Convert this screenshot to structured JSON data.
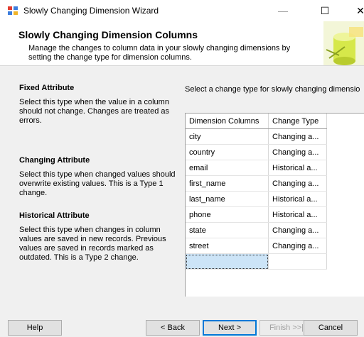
{
  "window": {
    "title": "Slowly Changing Dimension Wizard"
  },
  "header": {
    "title": "Slowly Changing Dimension Columns",
    "description": "Manage the changes to column data in your slowly changing dimensions by setting the change type for dimension columns."
  },
  "sections": {
    "fixed": {
      "title": "Fixed Attribute",
      "body": "Select this type when the value in a column should not change. Changes are treated as errors."
    },
    "changing": {
      "title": "Changing Attribute",
      "body": "Select this type when changed values should overwrite existing values. This is a Type 1 change."
    },
    "historical": {
      "title": "Historical Attribute",
      "body": "Select this type when changes in column values are saved in new records. Previous values are saved in records marked as outdated. This is a Type 2 change."
    }
  },
  "instruction": "Select a change type for slowly changing dimensio",
  "grid": {
    "headers": [
      "Dimension Columns",
      "Change Type"
    ],
    "rows": [
      [
        "city",
        "Changing a..."
      ],
      [
        "country",
        "Changing a..."
      ],
      [
        "email",
        "Historical a..."
      ],
      [
        "first_name",
        "Changing a..."
      ],
      [
        "last_name",
        "Historical a..."
      ],
      [
        "phone",
        "Historical a..."
      ],
      [
        "state",
        "Changing a..."
      ],
      [
        "street",
        "Changing a..."
      ]
    ]
  },
  "footer": {
    "help": "Help",
    "back": "< Back",
    "next": "Next >",
    "finish": "Finish >>|",
    "cancel": "Cancel"
  },
  "icons": {
    "app": "wizard-app-icon",
    "minimize": "minimize-icon",
    "maximize": "maximize-icon",
    "close": "close-icon",
    "header_graphic": "database-cylinder-icon"
  },
  "colors": {
    "selection": "#cce4f7",
    "default_button_border": "#0078d7",
    "panel_bg": "#f0f0f0"
  }
}
